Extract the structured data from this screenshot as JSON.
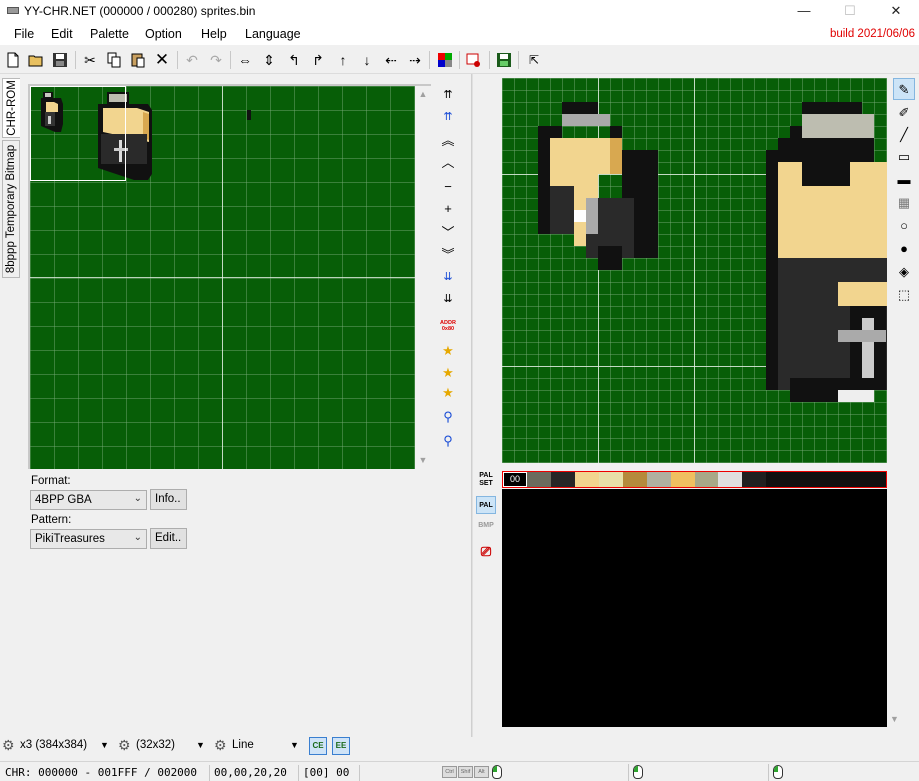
{
  "window": {
    "title": "YY-CHR.NET (000000 / 000280) sprites.bin",
    "minimize": "—",
    "maximize": "☐",
    "close": "✕"
  },
  "menu": {
    "items": [
      "File",
      "Edit",
      "Palette",
      "Option",
      "Help",
      "Language"
    ],
    "build": "build 2021/06/06"
  },
  "toolbar": {
    "icons": [
      "new-file-icon",
      "open-folder-icon",
      "save-icon",
      "cut-icon",
      "copy-icon",
      "paste-icon",
      "delete-icon",
      "undo-icon",
      "redo-icon",
      "flip-horizontal-icon",
      "flip-vertical-icon",
      "rotate-left-icon",
      "rotate-right-icon",
      "shift-up-icon",
      "shift-down-icon",
      "shift-left-icon",
      "shift-right-icon",
      "palette-table-icon",
      "bitmap-export-icon",
      "save-palette-icon",
      "external-icon"
    ]
  },
  "tabs": {
    "chr_rom": "CHR-ROM",
    "temp_bitmap": "8bppp Temporary Bitmap"
  },
  "chr_panel": {
    "scroll_up": "▲",
    "scroll_down": "▼"
  },
  "side_tools": {
    "addr_label": "ADDR 0x80"
  },
  "format": {
    "label": "Format:",
    "value": "4BPP GBA",
    "info_button": "Info.."
  },
  "pattern": {
    "label": "Pattern:",
    "value": "PikiTreasures",
    "edit_button": "Edit.."
  },
  "palette_tools": {
    "pal_set": "PAL SET",
    "pal": "PAL",
    "bmp": "BMP"
  },
  "palette": {
    "selected_index": "00",
    "colors": [
      "#000000",
      "#6b6b5e",
      "#262626",
      "#f2d58f",
      "#e8e0a8",
      "#b58a3c",
      "#b0b0a0",
      "#f0c060",
      "#a8a888",
      "#e0e0e0",
      "#202020",
      "#101010",
      "#101010",
      "#101010",
      "#101010",
      "#101010"
    ]
  },
  "bottom": {
    "zoom": "x3 (384x384)",
    "grid": "(32x32)",
    "tool": "Line"
  },
  "status": {
    "chr_range": "CHR: 000000 - 001FFF / 002000",
    "coords": "00,00,20,20",
    "color_index": "[00] 00",
    "keys": [
      "Ctrl",
      "Shif",
      "Alt"
    ]
  }
}
